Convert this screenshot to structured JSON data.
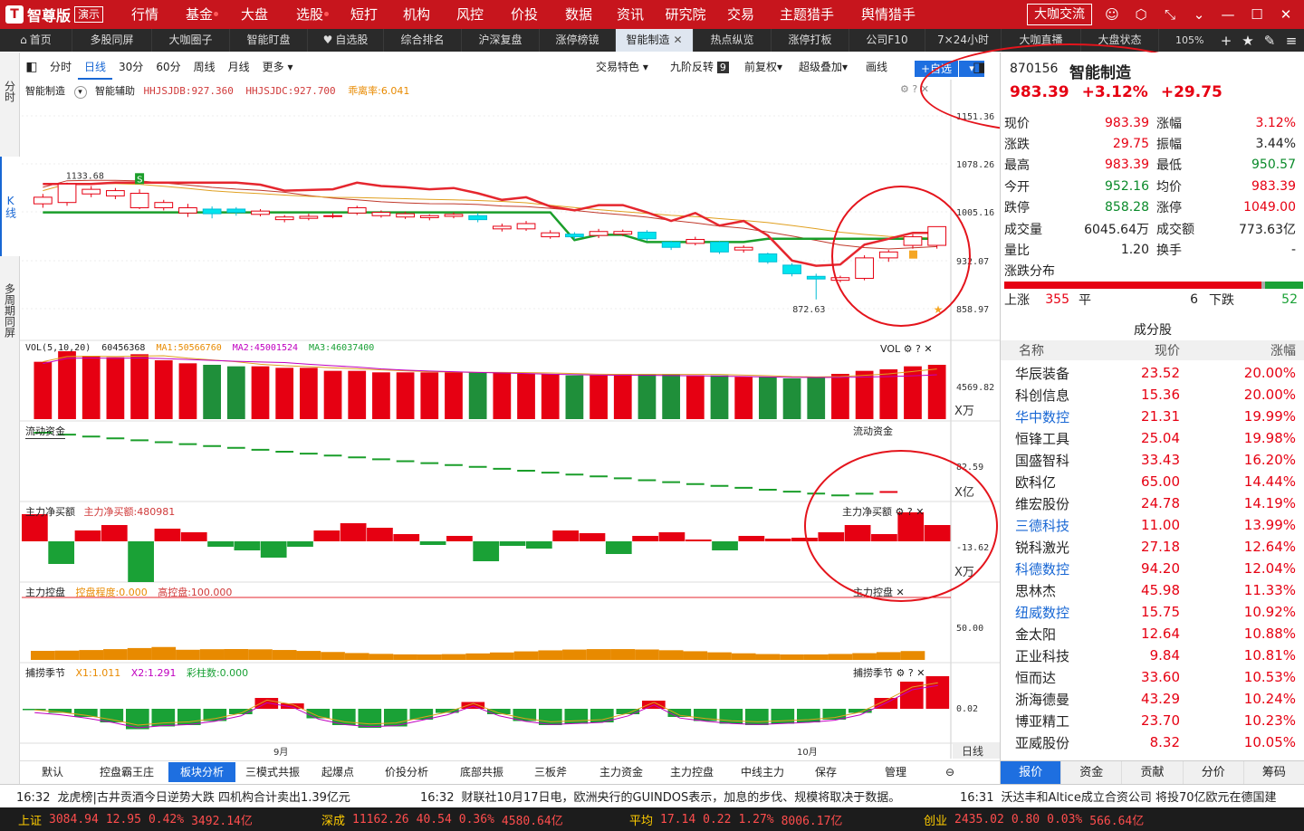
{
  "brand": {
    "name": "智尊版",
    "badge": "演示",
    "logo_char": "T"
  },
  "menu": [
    {
      "label": "行情",
      "dot": false
    },
    {
      "label": "基金",
      "dot": true
    },
    {
      "label": "大盘",
      "dot": false
    },
    {
      "label": "选股",
      "dot": true
    },
    {
      "label": "短打",
      "dot": false
    },
    {
      "label": "机构",
      "dot": false
    },
    {
      "label": "风控",
      "dot": false
    },
    {
      "label": "价投",
      "dot": false
    },
    {
      "label": "数据",
      "dot": false
    },
    {
      "label": "资讯",
      "dot": false
    },
    {
      "label": "研究院",
      "dot": false
    },
    {
      "label": "交易",
      "dot": false
    },
    {
      "label": "主题猎手",
      "dot": false
    },
    {
      "label": "舆情猎手",
      "dot": false
    }
  ],
  "dakajiaoliu": "大咖交流",
  "tabs": [
    {
      "label": "首页",
      "icon": "⌂"
    },
    {
      "label": "多股同屏"
    },
    {
      "label": "大咖圈子"
    },
    {
      "label": "智能盯盘"
    },
    {
      "label": "自选股",
      "icon": "♥"
    },
    {
      "label": "综合排名"
    },
    {
      "label": "沪深复盘"
    },
    {
      "label": "涨停榜镜"
    },
    {
      "label": "智能制造",
      "active": true
    },
    {
      "label": "热点纵览"
    },
    {
      "label": "涨停打板"
    },
    {
      "label": "公司F10"
    },
    {
      "label": "7×24小时"
    },
    {
      "label": "大咖直播"
    },
    {
      "label": "大盘状态"
    }
  ],
  "zoom": "105%",
  "left_rail": [
    "分时",
    "K线",
    "多周期同屏"
  ],
  "periods": [
    "分时",
    "日线",
    "30分",
    "60分",
    "周线",
    "月线",
    "更多 ▾"
  ],
  "toolbar_right": {
    "trade_feature": "交易特色 ▾",
    "jiujie": "九阶反转",
    "jiujie_badge": "9",
    "fuquan": "前复权▾",
    "overlay": "超级叠加▾",
    "draw": "画线",
    "add": "+自选",
    "add_arrow": "▾"
  },
  "chart_labels": {
    "main": {
      "name": "智能制造",
      "aux": "智能辅助",
      "a": "HHJSJDB:927.360",
      "b": "HHJSJDC:927.700",
      "c": "乖离率:6.041"
    },
    "high_marker": "1133.68",
    "low_marker": "872.63",
    "vol": {
      "name": "VOL(5,10,20)",
      "v": "60456368",
      "ma1": "MA1:50566760",
      "ma2": "MA2:45001524",
      "ma3": "MA3:46037400",
      "right": "VOL"
    },
    "liquid": {
      "name": "流动资金",
      "right": "流动资金"
    },
    "net": {
      "name": "主力净买额",
      "val": "主力净买额:480981",
      "right": "主力净买额"
    },
    "control": {
      "name": "主力控盘",
      "a": "控盘程度:0.000",
      "b": "高控盘:100.000",
      "right": "主力控盘"
    },
    "season": {
      "name": "捕捞季节",
      "x1": "X1:1.011",
      "x2": "X2:1.291",
      "cz": "彩柱数:0.000",
      "right": "捕捞季节"
    },
    "axis": {
      "main": [
        "1151.36",
        "1078.26",
        "1005.16",
        "932.07",
        "858.97"
      ],
      "vol": "4569.82",
      "vol_unit": "X万",
      "liquid": "82.59",
      "liquid_unit": "X亿",
      "net": "-13.62",
      "net_unit": "X万",
      "control": "50.00",
      "season": "0.02",
      "period": "日线"
    },
    "months": [
      "9月",
      "10月"
    ]
  },
  "candles": [
    {
      "o": 1018,
      "c": 1028,
      "h": 1033,
      "l": 1012
    },
    {
      "o": 1020,
      "c": 1048,
      "h": 1050,
      "l": 1015
    },
    {
      "o": 1033,
      "c": 1040,
      "h": 1045,
      "l": 1028
    },
    {
      "o": 1030,
      "c": 1038,
      "h": 1042,
      "l": 1025
    },
    {
      "o": 1012,
      "c": 1034,
      "h": 1040,
      "l": 1010
    },
    {
      "o": 1012,
      "c": 1020,
      "h": 1024,
      "l": 1008
    },
    {
      "o": 1004,
      "c": 1012,
      "h": 1018,
      "l": 998
    },
    {
      "o": 1010,
      "c": 1003,
      "h": 1014,
      "l": 996
    },
    {
      "o": 1010,
      "c": 1005,
      "h": 1013,
      "l": 1000
    },
    {
      "o": 1002,
      "c": 1007,
      "h": 1010,
      "l": 999
    },
    {
      "o": 994,
      "c": 998,
      "h": 1001,
      "l": 990
    },
    {
      "o": 996,
      "c": 999,
      "h": 1003,
      "l": 993
    },
    {
      "o": 1000,
      "c": 1000,
      "h": 1004,
      "l": 996
    },
    {
      "o": 1004,
      "c": 1012,
      "h": 1015,
      "l": 1001
    },
    {
      "o": 1000,
      "c": 1005,
      "h": 1008,
      "l": 997
    },
    {
      "o": 998,
      "c": 1003,
      "h": 1006,
      "l": 995
    },
    {
      "o": 997,
      "c": 1000,
      "h": 1002,
      "l": 993
    },
    {
      "o": 999,
      "c": 1002,
      "h": 1005,
      "l": 996
    },
    {
      "o": 1000,
      "c": 994,
      "h": 1004,
      "l": 990
    },
    {
      "o": 980,
      "c": 984,
      "h": 988,
      "l": 976
    },
    {
      "o": 980,
      "c": 988,
      "h": 992,
      "l": 977
    },
    {
      "o": 968,
      "c": 974,
      "h": 978,
      "l": 965
    },
    {
      "o": 972,
      "c": 968,
      "h": 975,
      "l": 964
    },
    {
      "o": 970,
      "c": 976,
      "h": 980,
      "l": 966
    },
    {
      "o": 972,
      "c": 976,
      "h": 979,
      "l": 969
    },
    {
      "o": 975,
      "c": 965,
      "h": 978,
      "l": 962
    },
    {
      "o": 960,
      "c": 952,
      "h": 962,
      "l": 948
    },
    {
      "o": 958,
      "c": 964,
      "h": 968,
      "l": 955
    },
    {
      "o": 960,
      "c": 945,
      "h": 962,
      "l": 942
    },
    {
      "o": 948,
      "c": 952,
      "h": 955,
      "l": 944
    },
    {
      "o": 942,
      "c": 930,
      "h": 944,
      "l": 927
    },
    {
      "o": 925,
      "c": 912,
      "h": 928,
      "l": 908
    },
    {
      "o": 908,
      "c": 904,
      "h": 912,
      "l": 873
    },
    {
      "o": 902,
      "c": 906,
      "h": 909,
      "l": 899
    },
    {
      "o": 905,
      "c": 936,
      "h": 940,
      "l": 902
    },
    {
      "o": 936,
      "c": 945,
      "h": 948,
      "l": 930
    },
    {
      "o": 955,
      "c": 968,
      "h": 972,
      "l": 950
    },
    {
      "o": 955,
      "c": 983.39,
      "h": 983.39,
      "l": 950
    }
  ],
  "volumes": [
    38,
    45,
    42,
    41,
    43,
    39,
    37,
    36,
    35,
    35,
    34,
    34,
    32,
    32,
    31,
    31,
    31,
    31,
    31,
    31,
    30,
    30,
    29,
    29,
    30,
    30,
    30,
    29,
    29,
    28,
    28,
    27,
    28,
    30,
    32,
    33,
    35,
    36
  ],
  "net_flow": [
    30,
    -25,
    12,
    18,
    -45,
    14,
    10,
    -6,
    -10,
    -18,
    -6,
    12,
    20,
    15,
    8,
    -4,
    6,
    -22,
    -5,
    -8,
    12,
    9,
    -14,
    6,
    10,
    2,
    -10,
    6,
    3,
    4,
    10,
    18,
    8,
    32,
    18
  ],
  "season_bars": [
    -1,
    -3,
    -6,
    -10,
    -15,
    -13,
    -12,
    -9,
    -4,
    8,
    4,
    -7,
    -12,
    -14,
    -13,
    -8,
    -3,
    5,
    -4,
    -9,
    -12,
    -11,
    -10,
    -4,
    6,
    -6,
    -9,
    -11,
    -12,
    -11,
    -10,
    -8,
    -3,
    8,
    20,
    24
  ],
  "quote": {
    "code": "870156",
    "name": "智能制造",
    "price": "983.39",
    "pct": "+3.12%",
    "chg": "+29.75",
    "rows": [
      {
        "l": "现价",
        "v": "983.39",
        "l2": "涨幅",
        "v2": "3.12%",
        "c1": "#e60012",
        "c2": "#e60012"
      },
      {
        "l": "涨跌",
        "v": "29.75",
        "l2": "振幅",
        "v2": "3.44%",
        "c1": "#e60012",
        "c2": "#222"
      },
      {
        "l": "最高",
        "v": "983.39",
        "l2": "最低",
        "v2": "950.57",
        "c1": "#e60012",
        "c2": "#0a8a2a"
      },
      {
        "l": "今开",
        "v": "952.16",
        "l2": "均价",
        "v2": "983.39",
        "c1": "#0a8a2a",
        "c2": "#e60012"
      },
      {
        "l": "跌停",
        "v": "858.28",
        "l2": "涨停",
        "v2": "1049.00",
        "c1": "#0a8a2a",
        "c2": "#e60012"
      },
      {
        "l": "成交量",
        "v": "6045.64万",
        "l2": "成交额",
        "v2": "773.63亿",
        "c1": "#222",
        "c2": "#222"
      },
      {
        "l": "量比",
        "v": "1.20",
        "l2": "换手",
        "v2": "-",
        "c1": "#222",
        "c2": "#222"
      }
    ],
    "dist_title": "涨跌分布",
    "up_label": "上涨",
    "up": "355",
    "flat_label": "平",
    "flat": "6",
    "down_label": "下跌",
    "down": "52",
    "up_share": 0.86,
    "flat_share": 0.014
  },
  "constituents": {
    "title": "成分股",
    "headers": [
      "名称",
      "现价",
      "涨幅"
    ],
    "rows": [
      {
        "n": "华辰装备",
        "p": "23.52",
        "c": "20.00%",
        "link": false
      },
      {
        "n": "科创信息",
        "p": "15.36",
        "c": "20.00%",
        "link": false
      },
      {
        "n": "华中数控",
        "p": "21.31",
        "c": "19.99%",
        "link": true
      },
      {
        "n": "恒锋工具",
        "p": "25.04",
        "c": "19.98%",
        "link": false
      },
      {
        "n": "国盛智科",
        "p": "33.43",
        "c": "16.20%",
        "link": false
      },
      {
        "n": "欧科亿",
        "p": "65.00",
        "c": "14.44%",
        "link": false
      },
      {
        "n": "维宏股份",
        "p": "24.78",
        "c": "14.19%",
        "link": false
      },
      {
        "n": "三德科技",
        "p": "11.00",
        "c": "13.99%",
        "link": true
      },
      {
        "n": "锐科激光",
        "p": "27.18",
        "c": "12.64%",
        "link": false
      },
      {
        "n": "科德数控",
        "p": "94.20",
        "c": "12.04%",
        "link": true
      },
      {
        "n": "思林杰",
        "p": "45.98",
        "c": "11.33%",
        "link": false
      },
      {
        "n": "纽威数控",
        "p": "15.75",
        "c": "10.92%",
        "link": true
      },
      {
        "n": "金太阳",
        "p": "12.64",
        "c": "10.88%",
        "link": false
      },
      {
        "n": "正业科技",
        "p": "9.84",
        "c": "10.81%",
        "link": false
      },
      {
        "n": "恒而达",
        "p": "33.60",
        "c": "10.53%",
        "link": false
      },
      {
        "n": "浙海德曼",
        "p": "43.29",
        "c": "10.24%",
        "link": false
      },
      {
        "n": "博亚精工",
        "p": "23.70",
        "c": "10.23%",
        "link": false
      },
      {
        "n": "亚威股份",
        "p": "8.32",
        "c": "10.05%",
        "link": false
      }
    ]
  },
  "rtabs": [
    "报价",
    "资金",
    "贡献",
    "分价",
    "筹码"
  ],
  "ind_tabs": [
    "默认",
    "控盘霸王庄",
    "板块分析",
    "三模式共振",
    "起爆点",
    "价投分析",
    "底部共振",
    "三板斧",
    "主力资金",
    "主力控盘",
    "中线主力",
    "保存",
    "管理"
  ],
  "news": [
    {
      "t": "16:32",
      "s": "龙虎榜|古井贡酒今日逆势大跌 四机构合计卖出1.39亿元"
    },
    {
      "t": "16:32",
      "s": "财联社10月17日电，欧洲央行的GUINDOS表示，加息的步伐、规模将取决于数据。"
    },
    {
      "t": "16:31",
      "s": "沃达丰和Altice成立合资公司 将投70亿欧元在德国建"
    }
  ],
  "indices": [
    {
      "n": "上证",
      "v": "3084.94",
      "c": "12.95",
      "p": "0.42%",
      "a": "3492.14亿"
    },
    {
      "n": "深成",
      "v": "11162.26",
      "c": "40.54",
      "p": "0.36%",
      "a": "4580.64亿"
    },
    {
      "n": "平均",
      "v": "17.14",
      "c": "0.22",
      "p": "1.27%",
      "a": "8006.17亿"
    },
    {
      "n": "创业",
      "v": "2435.02",
      "c": "0.80",
      "p": "0.03%",
      "a": "566.64亿"
    }
  ],
  "colors": {
    "up": "#e60012",
    "down": "#1aa136",
    "cyan": "#00e5ee",
    "brand": "#c7151d",
    "accent": "#1e6fe0"
  }
}
